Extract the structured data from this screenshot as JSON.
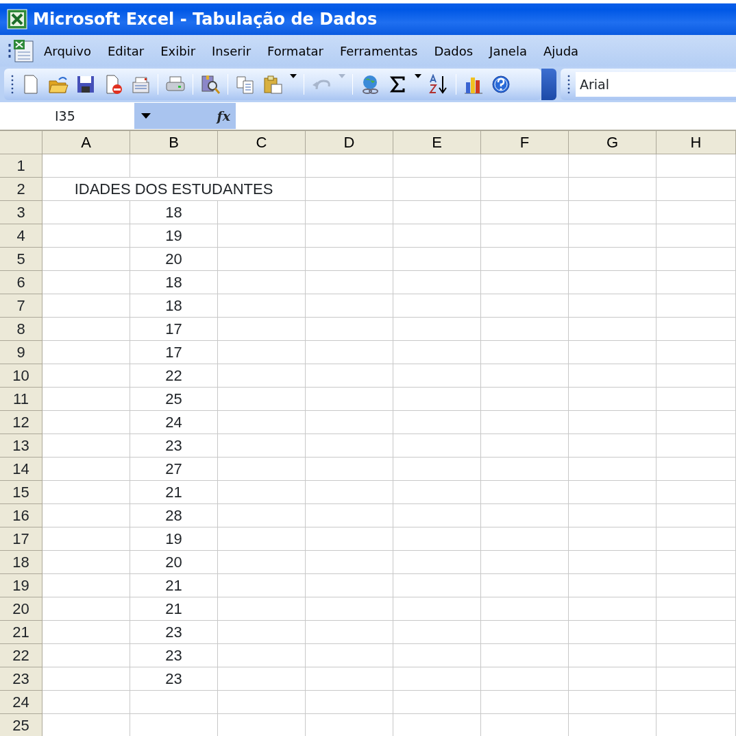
{
  "window": {
    "title": "Microsoft Excel - Tabulação de Dados"
  },
  "menu": [
    "Arquivo",
    "Editar",
    "Exibir",
    "Inserir",
    "Formatar",
    "Ferramentas",
    "Dados",
    "Janela",
    "Ajuda"
  ],
  "toolbar": {
    "undo_disabled": true,
    "font": "Arial"
  },
  "formula_bar": {
    "name_box": "I35",
    "fx": "fx"
  },
  "columns": [
    "A",
    "B",
    "C",
    "D",
    "E",
    "F",
    "G",
    "H"
  ],
  "rows": [
    {
      "header": "1"
    },
    {
      "header": "2",
      "title": "IDADES DOS ESTUDANTES"
    },
    {
      "header": "3",
      "b": "18"
    },
    {
      "header": "4",
      "b": "19"
    },
    {
      "header": "5",
      "b": "20"
    },
    {
      "header": "6",
      "b": "18"
    },
    {
      "header": "7",
      "b": "18"
    },
    {
      "header": "8",
      "b": "17"
    },
    {
      "header": "9",
      "b": "17"
    },
    {
      "header": "10",
      "b": "22"
    },
    {
      "header": "11",
      "b": "25"
    },
    {
      "header": "12",
      "b": "24"
    },
    {
      "header": "13",
      "b": "23"
    },
    {
      "header": "14",
      "b": "27"
    },
    {
      "header": "15",
      "b": "21"
    },
    {
      "header": "16",
      "b": "28"
    },
    {
      "header": "17",
      "b": "19"
    },
    {
      "header": "18",
      "b": "20"
    },
    {
      "header": "19",
      "b": "21"
    },
    {
      "header": "20",
      "b": "21"
    },
    {
      "header": "21",
      "b": "23"
    },
    {
      "header": "22",
      "b": "23"
    },
    {
      "header": "23",
      "b": "23"
    },
    {
      "header": "24"
    },
    {
      "header": "25"
    }
  ]
}
